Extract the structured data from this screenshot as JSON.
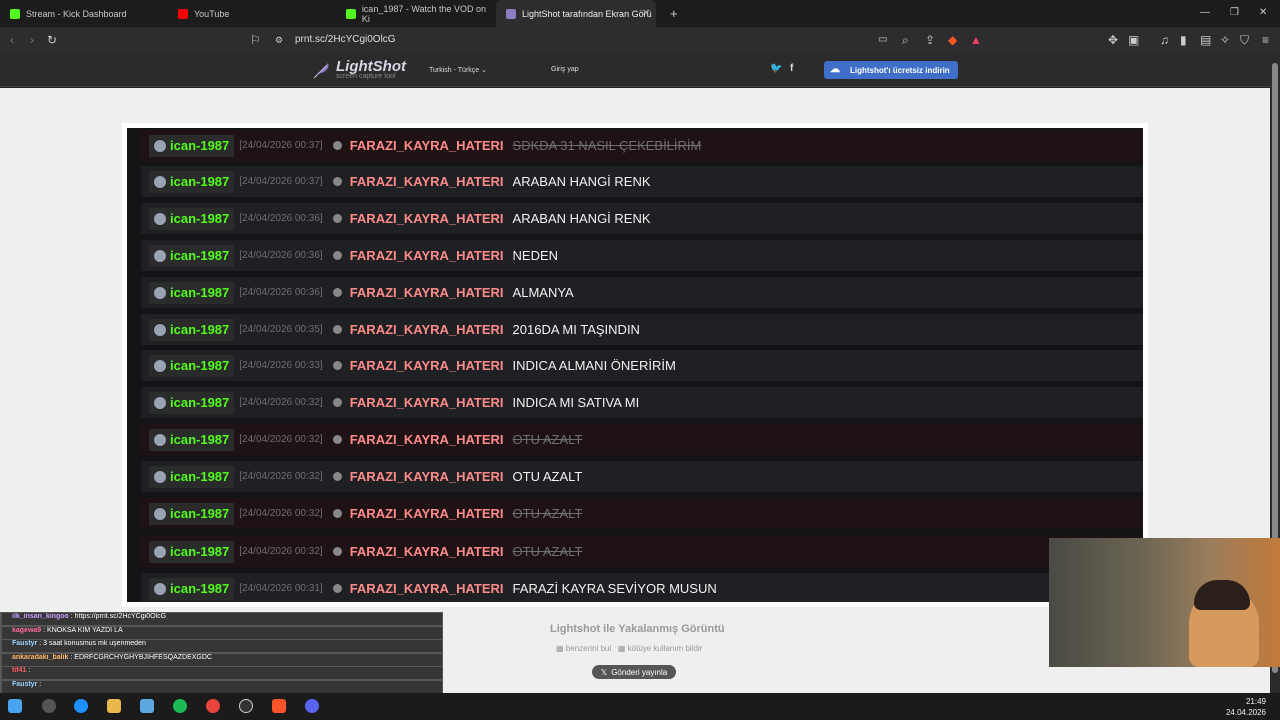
{
  "browser": {
    "tabs": [
      {
        "title": "Stream - Kick Dashboard"
      },
      {
        "title": "YouTube"
      },
      {
        "title": "ican_1987 - Watch the VOD on Ki"
      },
      {
        "title": "LightShot tarafından Ekran Görü"
      }
    ],
    "new_tab": "+",
    "url": "prnt.sc/2HcYCgi0OlcG"
  },
  "lightshot": {
    "logo_name": "LightShot",
    "logo_tagline": "screen capture tool",
    "language": "Turkish - Türkçe",
    "login": "Giriş yap",
    "download_button": "Lightshot'ı ücretsiz indirin",
    "caption": "Lightshot ile Yakalanmış Görüntü",
    "similar_link": "benzerini bul",
    "report_link": "kötüye kullanım bildir",
    "tweet_button": "Gönderi yayınla"
  },
  "chat_log": [
    {
      "user": "ican-1987",
      "time": "[24/04/2026 00:37]",
      "sender": "FARAZI_KAYRA_HATERI",
      "message": "SDKDA 31 NASIL ÇEKEBİLİRİM",
      "deleted": true
    },
    {
      "user": "ican-1987",
      "time": "[24/04/2026 00:37]",
      "sender": "FARAZI_KAYRA_HATERI",
      "message": "ARABAN HANGİ RENK",
      "deleted": false
    },
    {
      "user": "ican-1987",
      "time": "[24/04/2026 00:36]",
      "sender": "FARAZI_KAYRA_HATERI",
      "message": "ARABAN HANGİ RENK",
      "deleted": false
    },
    {
      "user": "ican-1987",
      "time": "[24/04/2026 00:36]",
      "sender": "FARAZI_KAYRA_HATERI",
      "message": "NEDEN",
      "deleted": false
    },
    {
      "user": "ican-1987",
      "time": "[24/04/2026 00:36]",
      "sender": "FARAZI_KAYRA_HATERI",
      "message": "ALMANYA",
      "deleted": false
    },
    {
      "user": "ican-1987",
      "time": "[24/04/2026 00:35]",
      "sender": "FARAZI_KAYRA_HATERI",
      "message": "2016DA MI TAŞINDIN",
      "deleted": false
    },
    {
      "user": "ican-1987",
      "time": "[24/04/2026 00:33]",
      "sender": "FARAZI_KAYRA_HATERI",
      "message": "INDICA ALMANI ÖNERİRİM",
      "deleted": false
    },
    {
      "user": "ican-1987",
      "time": "[24/04/2026 00:32]",
      "sender": "FARAZI_KAYRA_HATERI",
      "message": "INDICA MI SATIVA MI",
      "deleted": false
    },
    {
      "user": "ican-1987",
      "time": "[24/04/2026 00:32]",
      "sender": "FARAZI_KAYRA_HATERI",
      "message": "OTU AZALT",
      "deleted": true
    },
    {
      "user": "ican-1987",
      "time": "[24/04/2026 00:32]",
      "sender": "FARAZI_KAYRA_HATERI",
      "message": "OTU AZALT",
      "deleted": false
    },
    {
      "user": "ican-1987",
      "time": "[24/04/2026 00:32]",
      "sender": "FARAZI_KAYRA_HATERI",
      "message": "OTU AZALT",
      "deleted": true
    },
    {
      "user": "ican-1987",
      "time": "[24/04/2026 00:32]",
      "sender": "FARAZI_KAYRA_HATERI",
      "message": "OTU AZALT",
      "deleted": true
    },
    {
      "user": "ican-1987",
      "time": "[24/04/2026 00:31]",
      "sender": "FARAZI_KAYRA_HATERI",
      "message": "FARAZİ KAYRA SEVİYOR MUSUN",
      "deleted": false
    }
  ],
  "stream_chat": [
    {
      "user": "ilk_insan_kingoo",
      "text": "https://prnt.sc/2HcYCgi0OlcG",
      "color": "#c9a0ff"
    },
    {
      "user": "kagewa9",
      "text": "KNOKSA KIM YAZDI LA",
      "color": "#ff6b9b"
    },
    {
      "user": "Faustyr",
      "text": "3 saat konusmus mk uşenmeden",
      "color": "#9bd4ff"
    },
    {
      "user": "ankaradaki_balik",
      "text": "EDRFCGRCHYGHYBJIHFESQAZDEXGDC",
      "color": "#ffb86b"
    },
    {
      "user": "tif41",
      "text": "",
      "color": "#ff5b5b"
    },
    {
      "user": "Faustyr",
      "text": "",
      "color": "#9bd4ff"
    }
  ],
  "taskbar": {
    "time": "21:49",
    "date": "24.04.2026"
  },
  "colors": {
    "kick_green": "#53fc18",
    "sender_pink": "#ff8a8a",
    "lightshot_blue": "#3f6fc8"
  }
}
